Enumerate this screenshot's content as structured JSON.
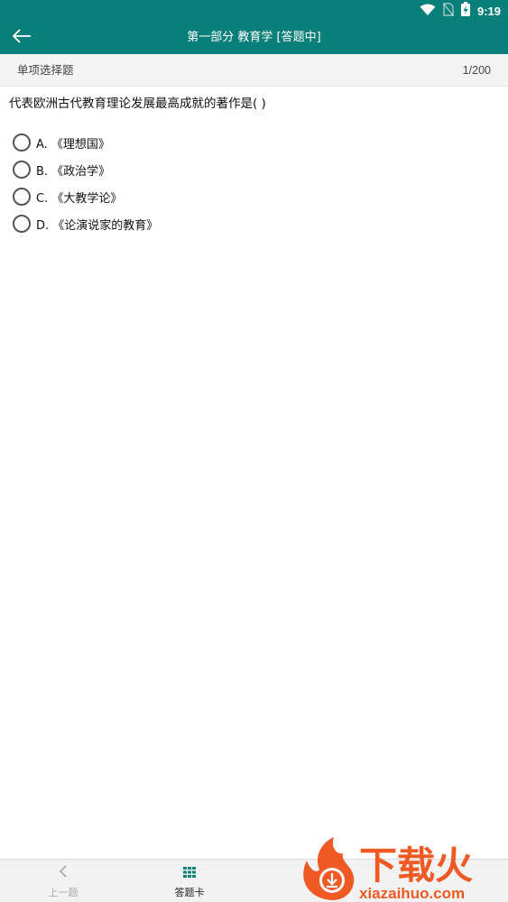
{
  "status_bar": {
    "time": "9:19",
    "icons": [
      "wifi-icon",
      "no-sim-icon",
      "battery-charging-icon"
    ]
  },
  "app_bar": {
    "back_icon": "arrow-left-icon",
    "title": "第一部分 教育学 [答题中]"
  },
  "section": {
    "type": "单项选择题",
    "progress": "1/200"
  },
  "question": {
    "text": "代表欧洲古代教育理论发展最高成就的著作是( )",
    "options": [
      "A. 《理想国》",
      "B. 《政治学》",
      "C. 《大教学论》",
      "D. 《论演说家的教育》"
    ]
  },
  "bottom_nav": {
    "prev_label": "上一题",
    "prev_icon": "chevron-left-icon",
    "card_label": "答题卡",
    "card_icon": "grid-icon"
  },
  "watermark": {
    "brand": "下载火",
    "domain": "xiazaihuo.com"
  },
  "colors": {
    "primary": "#087f78",
    "section_bg": "#f4f4f4",
    "watermark_orange": "#ef5a24"
  }
}
